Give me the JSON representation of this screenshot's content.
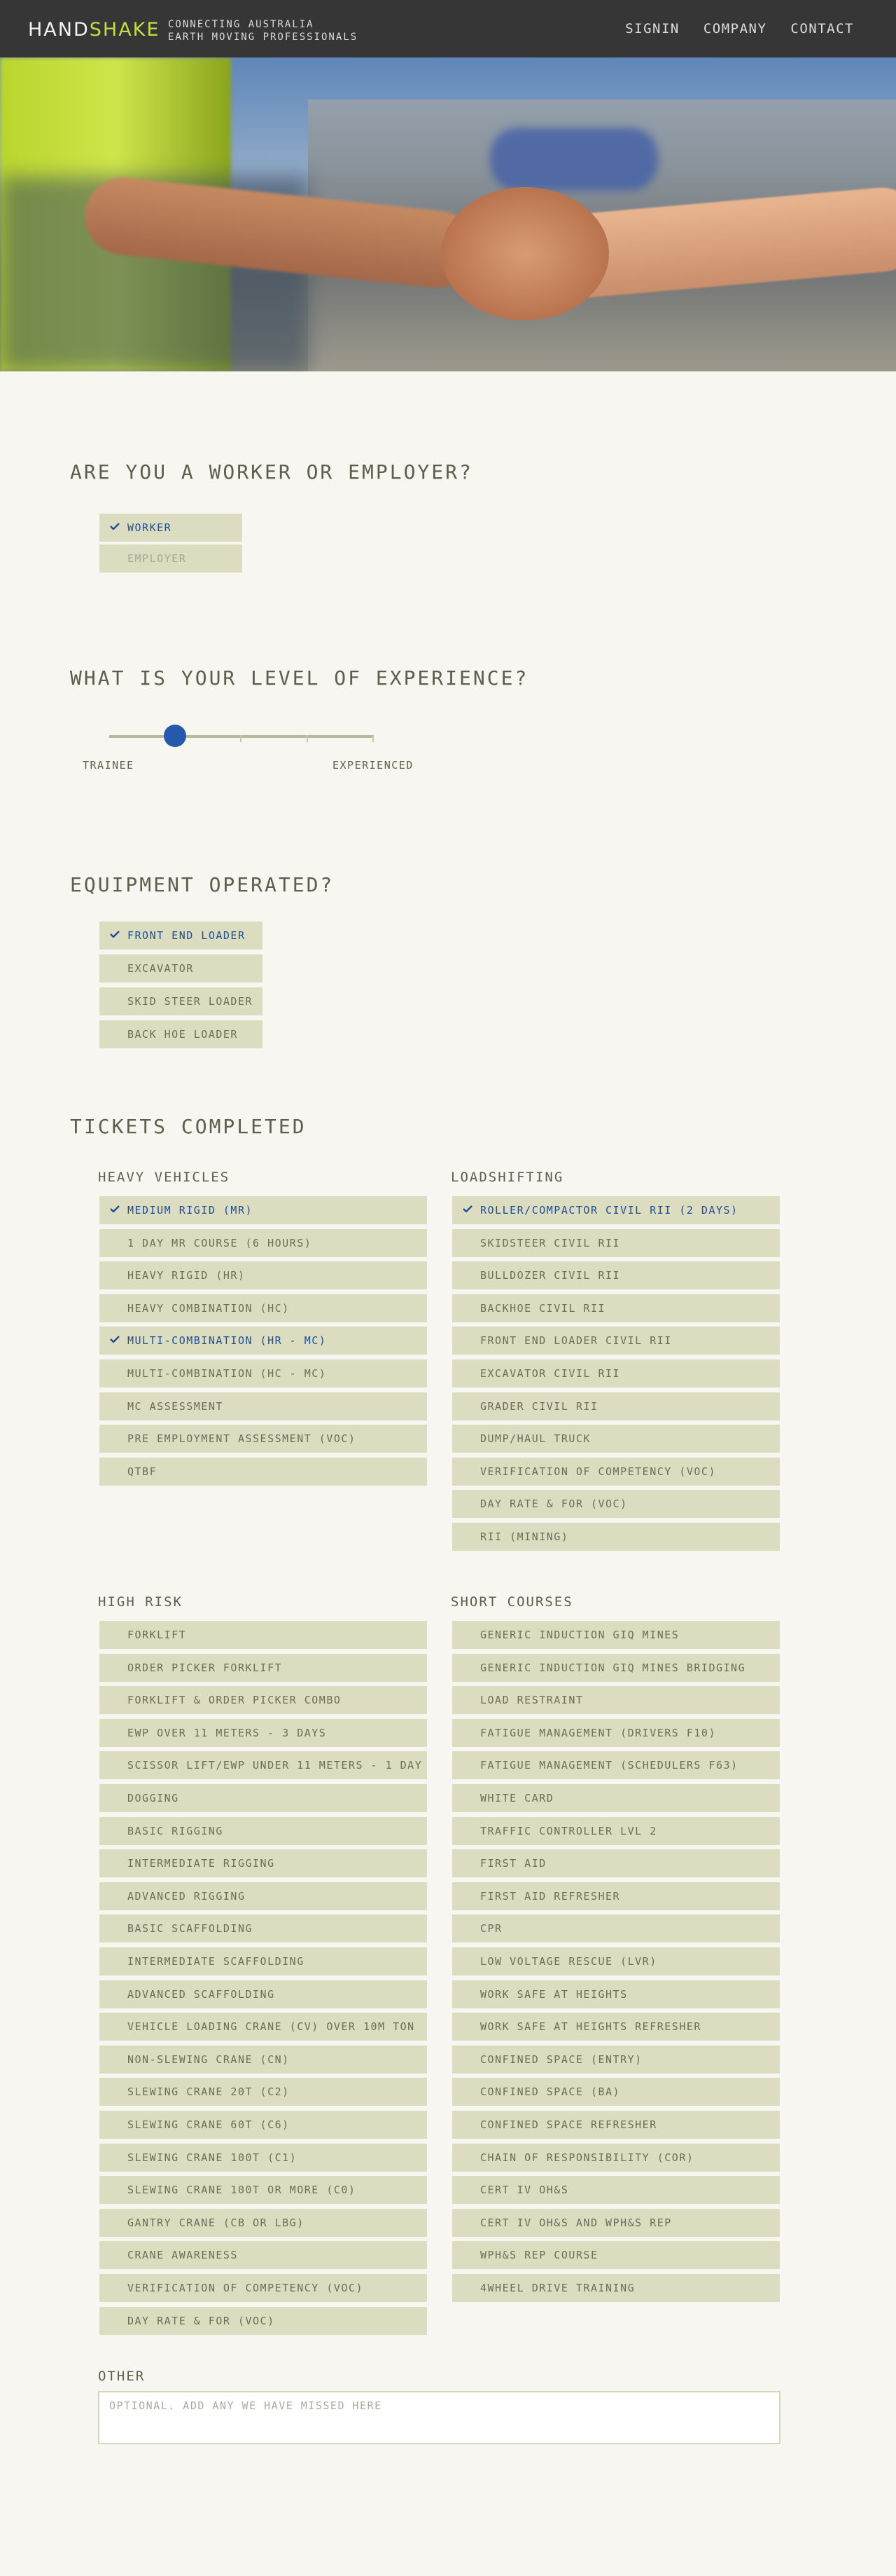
{
  "brand": {
    "part1": "HAND",
    "part2": "SHAKE",
    "tagline_1": "CONNECTING AUSTRALIA",
    "tagline_2": "EARTH MOVING PROFESSIONALS"
  },
  "nav": {
    "signin": "SIGNIN",
    "company": "COMPANY",
    "contact": "CONTACT"
  },
  "colors": {
    "header_bg": "#363636",
    "accent_green": "#c6dc47",
    "selected_blue": "#1d4f95",
    "option_bg": "#dcdcc0",
    "page_bg": "#f7f6f1"
  },
  "role": {
    "question": "ARE YOU A WORKER OR EMPLOYER?",
    "options": [
      {
        "label": "WORKER",
        "selected": true
      },
      {
        "label": "EMPLOYER",
        "selected": false
      }
    ]
  },
  "experience": {
    "question": "WHAT IS YOUR LEVEL OF EXPERIENCE?",
    "min_label": "TRAINEE",
    "max_label": "EXPERIENCED",
    "value_fraction": 0.25
  },
  "equipment": {
    "question": "EQUIPMENT OPERATED?",
    "options": [
      {
        "label": "FRONT END LOADER",
        "selected": true
      },
      {
        "label": "EXCAVATOR",
        "selected": false
      },
      {
        "label": "SKID STEER LOADER",
        "selected": false
      },
      {
        "label": "BACK HOE LOADER",
        "selected": false
      }
    ]
  },
  "tickets": {
    "title": "TICKETS COMPLETED",
    "heavy_vehicles": {
      "heading": "HEAVY VEHICLES",
      "items": [
        {
          "label": "MEDIUM RIGID (MR)",
          "selected": true
        },
        {
          "label": "1 DAY MR COURSE (6 HOURS)",
          "selected": false
        },
        {
          "label": "HEAVY RIGID (HR)",
          "selected": false
        },
        {
          "label": "HEAVY COMBINATION (HC)",
          "selected": false
        },
        {
          "label": "MULTI-COMBINATION (HR - MC)",
          "selected": true
        },
        {
          "label": "MULTI-COMBINATION (HC - MC)",
          "selected": false
        },
        {
          "label": "MC ASSESSMENT",
          "selected": false
        },
        {
          "label": "PRE EMPLOYMENT ASSESSMENT (VOC)",
          "selected": false
        },
        {
          "label": "QTBF",
          "selected": false
        }
      ]
    },
    "loadshifting": {
      "heading": "LOADSHIFTING",
      "items": [
        {
          "label": "ROLLER/COMPACTOR CIVIL RII (2 DAYS)",
          "selected": true
        },
        {
          "label": "SKIDSTEER CIVIL RII",
          "selected": false
        },
        {
          "label": "BULLDOZER CIVIL RII",
          "selected": false
        },
        {
          "label": "BACKHOE CIVIL RII",
          "selected": false
        },
        {
          "label": "FRONT END LOADER CIVIL RII",
          "selected": false
        },
        {
          "label": "EXCAVATOR CIVIL RII",
          "selected": false
        },
        {
          "label": "GRADER CIVIL RII",
          "selected": false
        },
        {
          "label": "DUMP/HAUL TRUCK",
          "selected": false
        },
        {
          "label": "VERIFICATION OF COMPETENCY (VOC)",
          "selected": false
        },
        {
          "label": "DAY RATE & FOR (VOC)",
          "selected": false
        },
        {
          "label": "RII (MINING)",
          "selected": false
        }
      ]
    },
    "high_risk": {
      "heading": "HIGH RISK",
      "items": [
        {
          "label": "FORKLIFT",
          "selected": false
        },
        {
          "label": "ORDER PICKER FORKLIFT",
          "selected": false
        },
        {
          "label": "FORKLIFT & ORDER PICKER COMBO",
          "selected": false
        },
        {
          "label": "EWP OVER 11 METERS - 3 DAYS",
          "selected": false
        },
        {
          "label": "SCISSOR LIFT/EWP UNDER 11 METERS - 1 DAY",
          "selected": false
        },
        {
          "label": "DOGGING",
          "selected": false
        },
        {
          "label": "BASIC RIGGING",
          "selected": false
        },
        {
          "label": "INTERMEDIATE RIGGING",
          "selected": false
        },
        {
          "label": "ADVANCED RIGGING",
          "selected": false
        },
        {
          "label": "BASIC SCAFFOLDING",
          "selected": false
        },
        {
          "label": "INTERMEDIATE SCAFFOLDING",
          "selected": false
        },
        {
          "label": "ADVANCED SCAFFOLDING",
          "selected": false
        },
        {
          "label": "VEHICLE LOADING CRANE (CV) OVER 10M TON",
          "selected": false
        },
        {
          "label": "NON-SLEWING CRANE (CN)",
          "selected": false
        },
        {
          "label": "SLEWING CRANE 20T (C2)",
          "selected": false
        },
        {
          "label": "SLEWING CRANE 60T (C6)",
          "selected": false
        },
        {
          "label": "SLEWING CRANE 100T (C1)",
          "selected": false
        },
        {
          "label": "SLEWING CRANE 100T OR MORE (C0)",
          "selected": false
        },
        {
          "label": "GANTRY CRANE (CB OR LBG)",
          "selected": false
        },
        {
          "label": "CRANE AWARENESS",
          "selected": false
        },
        {
          "label": "VERIFICATION OF COMPETENCY (VOC)",
          "selected": false
        },
        {
          "label": "DAY RATE & FOR (VOC)",
          "selected": false
        }
      ]
    },
    "short_courses": {
      "heading": "SHORT COURSES",
      "items": [
        {
          "label": "GENERIC INDUCTION GIQ MINES",
          "selected": false
        },
        {
          "label": "GENERIC INDUCTION GIQ MINES BRIDGING",
          "selected": false
        },
        {
          "label": "LOAD RESTRAINT",
          "selected": false
        },
        {
          "label": "FATIGUE MANAGEMENT (DRIVERS F10)",
          "selected": false
        },
        {
          "label": "FATIGUE MANAGEMENT (SCHEDULERS F63)",
          "selected": false
        },
        {
          "label": "WHITE CARD",
          "selected": false
        },
        {
          "label": "TRAFFIC CONTROLLER LVL 2",
          "selected": false
        },
        {
          "label": "FIRST AID",
          "selected": false
        },
        {
          "label": "FIRST AID REFRESHER",
          "selected": false
        },
        {
          "label": "CPR",
          "selected": false
        },
        {
          "label": "LOW VOLTAGE RESCUE (LVR)",
          "selected": false
        },
        {
          "label": "WORK SAFE AT HEIGHTS",
          "selected": false
        },
        {
          "label": "WORK SAFE AT HEIGHTS REFRESHER",
          "selected": false
        },
        {
          "label": "CONFINED SPACE (ENTRY)",
          "selected": false
        },
        {
          "label": "CONFINED SPACE (BA)",
          "selected": false
        },
        {
          "label": "CONFINED SPACE REFRESHER",
          "selected": false
        },
        {
          "label": "CHAIN OF RESPONSIBILITY (COR)",
          "selected": false
        },
        {
          "label": "CERT IV OH&S",
          "selected": false
        },
        {
          "label": "CERT IV OH&S AND WPH&S REP",
          "selected": false
        },
        {
          "label": "WPH&S REP COURSE",
          "selected": false
        },
        {
          "label": "4WHEEL DRIVE TRAINING",
          "selected": false
        }
      ]
    },
    "other": {
      "heading": "OTHER",
      "placeholder": "OPTIONAL. ADD ANY WE HAVE MISSED HERE",
      "value": ""
    }
  }
}
